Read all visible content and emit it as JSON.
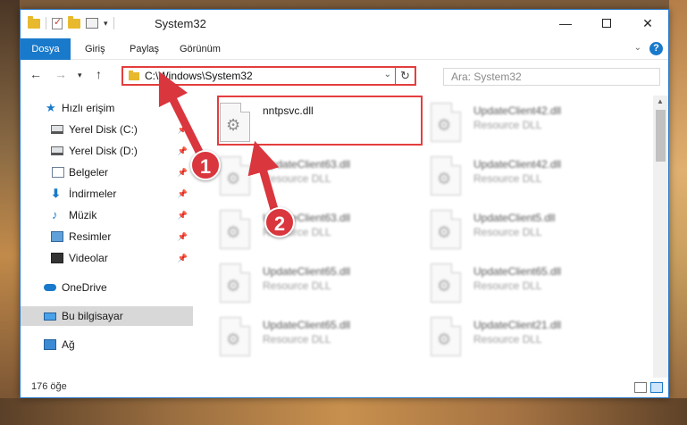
{
  "window": {
    "title": "System32",
    "buttons": {
      "minimize": "—",
      "close": "✕"
    }
  },
  "ribbon": {
    "tabs": [
      "Dosya",
      "Giriş",
      "Paylaş",
      "Görünüm"
    ],
    "help": "?"
  },
  "navigation": {
    "address": "C:\\Windows\\System32",
    "search_placeholder": "Ara: System32"
  },
  "sidebar": {
    "quick_access": "Hızlı erişim",
    "items": [
      {
        "label": "Yerel Disk (C:)",
        "icon": "drive-icon",
        "pinned": true
      },
      {
        "label": "Yerel Disk (D:)",
        "icon": "drive-icon",
        "pinned": true
      },
      {
        "label": "Belgeler",
        "icon": "documents-icon",
        "pinned": true
      },
      {
        "label": "İndirmeler",
        "icon": "downloads-icon",
        "pinned": true
      },
      {
        "label": "Müzik",
        "icon": "music-icon",
        "pinned": true
      },
      {
        "label": "Resimler",
        "icon": "pictures-icon",
        "pinned": true
      },
      {
        "label": "Videolar",
        "icon": "videos-icon",
        "pinned": true
      }
    ],
    "onedrive": "OneDrive",
    "this_pc": "Bu bilgisayar",
    "network": "Ağ"
  },
  "files": [
    {
      "name": "nntpsvc.dll",
      "type": "",
      "highlighted": true
    },
    {
      "name": "UpdateClient42.dll",
      "type": "Resource DLL"
    },
    {
      "name": "UpdateClient63.dll",
      "type": "Resource DLL"
    },
    {
      "name": "UpdateClient42.dll",
      "type": "Resource DLL"
    },
    {
      "name": "UpdateClient63.dll",
      "type": "Resource DLL"
    },
    {
      "name": "UpdateClient5.dll",
      "type": "Resource DLL"
    },
    {
      "name": "UpdateClient65.dll",
      "type": "Resource DLL"
    },
    {
      "name": "UpdateClient65.dll",
      "type": "Resource DLL"
    },
    {
      "name": "UpdateClient65.dll",
      "type": "Resource DLL"
    },
    {
      "name": "UpdateClient21.dll",
      "type": "Resource DLL"
    }
  ],
  "status": {
    "count": "176 öğe"
  },
  "annotations": {
    "step1": "1",
    "step2": "2",
    "color": "#d9363e"
  }
}
